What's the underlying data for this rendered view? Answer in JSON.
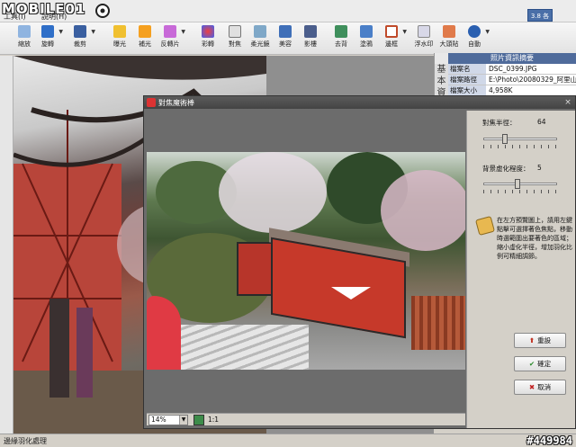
{
  "header": {
    "logo_text": "MOBILE01",
    "menu": [
      {
        "label": "工具(I)"
      },
      {
        "label": "說明(H)"
      }
    ]
  },
  "toolbar": {
    "tools": [
      {
        "label": "縮放",
        "icon": "zoom-icon"
      },
      {
        "label": "旋轉",
        "icon": "rotate-icon"
      },
      {
        "label": "裁剪",
        "icon": "crop-icon"
      },
      {
        "label": "曝光",
        "icon": "exposure-icon"
      },
      {
        "label": "補光",
        "icon": "fill-light-icon"
      },
      {
        "label": "反轉片",
        "icon": "reversal-film-icon"
      },
      {
        "label": "彩轉",
        "icon": "color-icon"
      },
      {
        "label": "對焦",
        "icon": "focus-icon"
      },
      {
        "label": "柔光鏡",
        "icon": "soft-light-icon"
      },
      {
        "label": "美容",
        "icon": "beauty-icon"
      },
      {
        "label": "影樓",
        "icon": "studio-icon"
      },
      {
        "label": "去背",
        "icon": "remove-bg-icon"
      },
      {
        "label": "塗鴉",
        "icon": "doodle-icon"
      },
      {
        "label": "邊框",
        "icon": "frame-icon"
      },
      {
        "label": "浮水印",
        "icon": "watermark-icon"
      },
      {
        "label": "大頭貼",
        "icon": "sticker-icon"
      },
      {
        "label": "自動",
        "icon": "auto-icon"
      }
    ],
    "corner_label": "3.8 各"
  },
  "info_panel": {
    "title": "照片資訊摘要",
    "side_text": "基本資",
    "rows": [
      {
        "key": "檔案名",
        "value": "DSC_0399.JPG"
      },
      {
        "key": "檔案路徑",
        "value": "E:\\Photo\\20080329_阿里山\\"
      },
      {
        "key": "檔案大小",
        "value": "4,958K"
      }
    ]
  },
  "dialog": {
    "title": "對焦魔術棒",
    "focus_radius_label": "對焦半徑：",
    "focus_radius_value": "64",
    "focus_radius_fraction": 0.26,
    "blur_level_label": "背景虛化程度：",
    "blur_level_value": "5",
    "blur_level_fraction": 0.45,
    "hint": "在左方預覽圖上，請用左鍵點擊可選擇著色焦點，移動時選範圍出要著色的區域；縮小虛化半徑，增加羽化比例可精細調節。",
    "buttons": {
      "reset": "重設",
      "ok": "確定",
      "cancel": "取消"
    },
    "zoom_value": "14%",
    "actual_size_label": "1:1"
  },
  "status": {
    "text": "邊緣羽化處理",
    "watermark": "#449984"
  },
  "colors": {
    "dialog_bg": "#6c6c6c",
    "info_title_bg": "#4f6b9b",
    "train_red": "#c6392a"
  }
}
